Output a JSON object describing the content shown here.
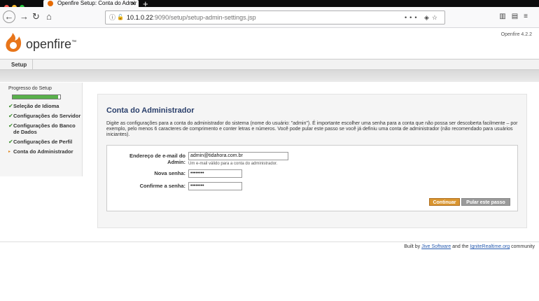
{
  "browser": {
    "tab_title": "Openfire Setup: Conta do Admir",
    "url_host": "10.1.0.22",
    "url_path": ":9090/setup/setup-admin-settings.jsp",
    "url_menu": "•••",
    "colors": {
      "close": "#ff5f57",
      "min": "#febc2e",
      "max": "#28c840"
    }
  },
  "header": {
    "logo_text": "openfire",
    "logo_tm": "™",
    "version": "Openfire 4.2.2"
  },
  "menu": {
    "setup_label": "Setup"
  },
  "sidebar": {
    "title": "Progresso do Setup",
    "progress_fraction": 0.95,
    "steps": [
      {
        "label": "Seleção de Idioma",
        "status": "done"
      },
      {
        "label": "Configurações do Servidor",
        "status": "done"
      },
      {
        "label": "Configurações do Banco de Dados",
        "status": "done"
      },
      {
        "label": "Configurações de Perfil",
        "status": "done"
      },
      {
        "label": "Conta do Administrador",
        "status": "current"
      }
    ],
    "done_mark": "✔",
    "current_mark": "▸"
  },
  "main": {
    "title": "Conta do Administrador",
    "description": "Digite as configurações para a conta do administrador do sistema (nome do usuário: \"admin\"). É importante escolher uma senha para a conta que não possa ser descoberta facilmente – por exemplo, pelo menos 6 caracteres de comprimento e conter letras e números. Você pode pular este passo se você já definiu uma conta de administrador (não recomendado para usuários iniciantes).",
    "email_label": "Endereço de e-mail do Admin:",
    "email_value": "admin@tidahora.com.br",
    "email_help": "Um e-mail válido para a conta do administrador.",
    "password_label": "Nova senha:",
    "password_value": "••••••••",
    "confirm_label": "Confirme a senha:",
    "confirm_value": "••••••••",
    "continue_label": "Continuar",
    "skip_label": "Pular este passo"
  },
  "footer": {
    "prefix": "Built by ",
    "link1": "Jive Software",
    "middle": " and the ",
    "link2": "IgniteRealtime.org",
    "suffix": " community"
  }
}
